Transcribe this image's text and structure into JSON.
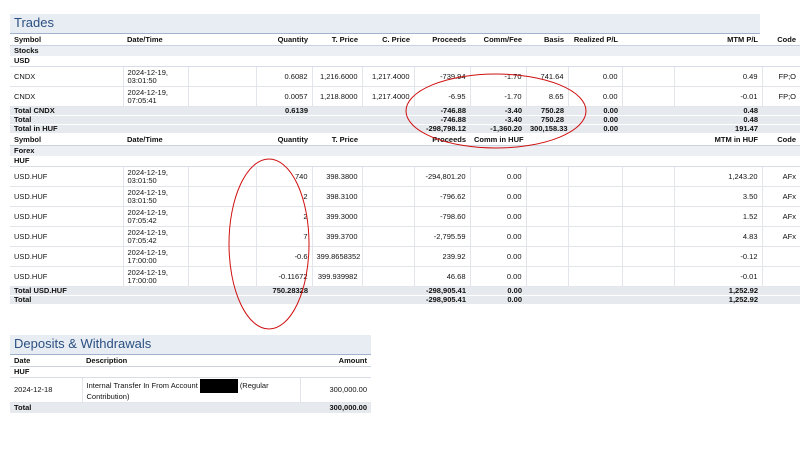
{
  "trades": {
    "title": "Trades",
    "stock_headers": [
      "Symbol",
      "Date/Time",
      "",
      "Quantity",
      "T. Price",
      "C. Price",
      "Proceeds",
      "Comm/Fee",
      "Basis",
      "Realized P/L",
      "",
      "MTM P/L",
      "Code"
    ],
    "stocks_label": "Stocks",
    "currency_label": "USD",
    "stock_rows": [
      {
        "symbol": "CNDX",
        "date": "2024-12-19,",
        "time": "03:01:50",
        "quantity": "0.6082",
        "t_price": "1,216.6000",
        "c_price": "1,217.4000",
        "proceeds": "-739.94",
        "comm": "-1.70",
        "basis": "741.64",
        "realized": "0.00",
        "mtm": "0.49",
        "code": "FP;O"
      },
      {
        "symbol": "CNDX",
        "date": "2024-12-19,",
        "time": "07:05:41",
        "quantity": "0.0057",
        "t_price": "1,218.8000",
        "c_price": "1,217.4000",
        "proceeds": "-6.95",
        "comm": "-1.70",
        "basis": "8.65",
        "realized": "0.00",
        "mtm": "-0.01",
        "code": "FP;O"
      }
    ],
    "stock_totals": [
      {
        "label": "Total CNDX",
        "quantity": "0.6139",
        "proceeds": "-746.88",
        "comm": "-3.40",
        "basis": "750.28",
        "realized": "0.00",
        "mtm": "0.48"
      },
      {
        "label": "Total",
        "quantity": "",
        "proceeds": "-746.88",
        "comm": "-3.40",
        "basis": "750.28",
        "realized": "0.00",
        "mtm": "0.48"
      },
      {
        "label": "Total in HUF",
        "quantity": "",
        "proceeds": "-298,798.12",
        "comm": "-1,360.20",
        "basis": "300,158.33",
        "realized": "0.00",
        "mtm": "191.47"
      }
    ],
    "forex_headers": [
      "Symbol",
      "Date/Time",
      "",
      "Quantity",
      "T. Price",
      "",
      "Proceeds",
      "Comm in HUF",
      "",
      "",
      "",
      "MTM in HUF",
      "Code"
    ],
    "forex_label": "Forex",
    "forex_currency_label": "HUF",
    "forex_rows": [
      {
        "symbol": "USD.HUF",
        "date": "2024-12-19,",
        "time": "03:01:50",
        "quantity": "740",
        "t_price": "398.3800",
        "proceeds": "-294,801.20",
        "comm": "0.00",
        "mtm": "1,243.20",
        "code": "AFx"
      },
      {
        "symbol": "USD.HUF",
        "date": "2024-12-19,",
        "time": "03:01:50",
        "quantity": "2",
        "t_price": "398.3100",
        "proceeds": "-796.62",
        "comm": "0.00",
        "mtm": "3.50",
        "code": "AFx"
      },
      {
        "symbol": "USD.HUF",
        "date": "2024-12-19,",
        "time": "07:05:42",
        "quantity": "2",
        "t_price": "399.3000",
        "proceeds": "-798.60",
        "comm": "0.00",
        "mtm": "1.52",
        "code": "AFx"
      },
      {
        "symbol": "USD.HUF",
        "date": "2024-12-19,",
        "time": "07:05:42",
        "quantity": "7",
        "t_price": "399.3700",
        "proceeds": "-2,795.59",
        "comm": "0.00",
        "mtm": "4.83",
        "code": "AFx"
      },
      {
        "symbol": "USD.HUF",
        "date": "2024-12-19,",
        "time": "17:00:00",
        "quantity": "-0.6",
        "t_price": "399.8658352",
        "proceeds": "239.92",
        "comm": "0.00",
        "mtm": "-0.12",
        "code": ""
      },
      {
        "symbol": "USD.HUF",
        "date": "2024-12-19,",
        "time": "17:00:00",
        "quantity": "-0.11672",
        "t_price": "399.939982",
        "proceeds": "46.68",
        "comm": "0.00",
        "mtm": "-0.01",
        "code": ""
      }
    ],
    "forex_totals": [
      {
        "label": "Total USD.HUF",
        "quantity": "750.28328",
        "proceeds": "-298,905.41",
        "comm": "0.00",
        "mtm": "1,252.92"
      },
      {
        "label": "Total",
        "quantity": "",
        "proceeds": "-298,905.41",
        "comm": "0.00",
        "mtm": "1,252.92"
      }
    ]
  },
  "deposits": {
    "title": "Deposits & Withdrawals",
    "headers": {
      "date": "Date",
      "description": "Description",
      "amount": "Amount"
    },
    "currency_label": "HUF",
    "row": {
      "date": "2024-12-18",
      "desc_before": "Internal Transfer In From Account",
      "desc_after": "(Regular",
      "desc_line2": "Contribution)",
      "amount": "300,000.00"
    },
    "total": {
      "label": "Total",
      "amount": "300,000.00"
    }
  },
  "annotations": {
    "color": "#d01010"
  }
}
